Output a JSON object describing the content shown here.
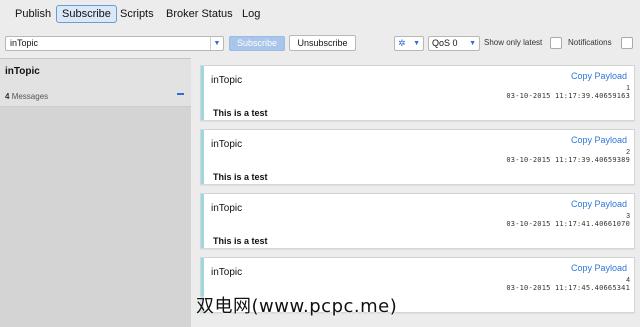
{
  "nav": {
    "tabs": [
      "Publish",
      "Subscribe",
      "Scripts",
      "Broker Status",
      "Log"
    ],
    "active_tab": "Subscribe"
  },
  "toolbar": {
    "topic_value": "inTopic",
    "subscribe_label": "Subscribe",
    "unsubscribe_label": "Unsubscribe",
    "qos_value": "QoS 0",
    "show_only_latest_label": "Show only latest",
    "notifications_label": "Notifications"
  },
  "subscriptions": {
    "topic": "inTopic",
    "count": "4",
    "count_suffix": "Messages"
  },
  "messages": [
    {
      "topic": "inTopic",
      "copy_label": "Copy Payload",
      "index": "1",
      "timestamp": "03-10-2015  11:17:39.40659163",
      "payload": "This is a test"
    },
    {
      "topic": "inTopic",
      "copy_label": "Copy Payload",
      "index": "2",
      "timestamp": "03-10-2015  11:17:39.40659389",
      "payload": "This is a test"
    },
    {
      "topic": "inTopic",
      "copy_label": "Copy Payload",
      "index": "3",
      "timestamp": "03-10-2015  11:17:41.40661070",
      "payload": "This is a test"
    },
    {
      "topic": "inTopic",
      "copy_label": "Copy Payload",
      "index": "4",
      "timestamp": "03-10-2015  11:17:45.40665341",
      "payload": ""
    }
  ],
  "watermark": "双电网(www.pcpc.me)",
  "colors": {
    "accent": "#2e6fcf",
    "active_tab_bg": "#dbe8f7",
    "message_bar": "#9fd8dc",
    "subscribe_button": "#a9c5ea"
  },
  "icons": {
    "topic_dropdown": "chevron-down-icon",
    "settings": "gear-icon",
    "collapse": "minus-icon"
  }
}
